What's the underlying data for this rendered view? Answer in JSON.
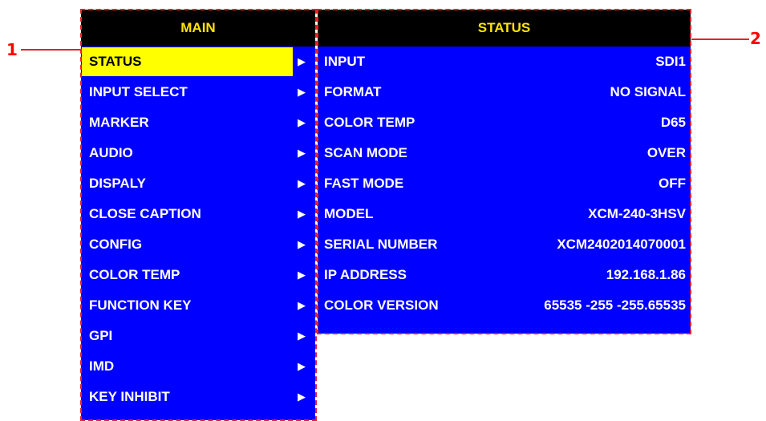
{
  "main": {
    "title": "MAIN",
    "items": [
      {
        "label": "STATUS",
        "arrow": "▶",
        "selected": true
      },
      {
        "label": "INPUT SELECT",
        "arrow": "▶"
      },
      {
        "label": "MARKER",
        "arrow": "▶"
      },
      {
        "label": "AUDIO",
        "arrow": "▶"
      },
      {
        "label": "DISPALY",
        "arrow": "▶"
      },
      {
        "label": "CLOSE CAPTION",
        "arrow": "▶"
      },
      {
        "label": "CONFIG",
        "arrow": "▶"
      },
      {
        "label": "COLOR TEMP",
        "arrow": "▶"
      },
      {
        "label": "FUNCTION KEY",
        "arrow": "▶"
      },
      {
        "label": "GPI",
        "arrow": "▶"
      },
      {
        "label": "IMD",
        "arrow": "▶"
      },
      {
        "label": "KEY INHIBIT",
        "arrow": "▶"
      }
    ]
  },
  "status": {
    "title": "STATUS",
    "rows": [
      {
        "label": "INPUT",
        "value": "SDI1"
      },
      {
        "label": "FORMAT",
        "value": "NO SIGNAL"
      },
      {
        "label": "COLOR TEMP",
        "value": "D65"
      },
      {
        "label": "SCAN MODE",
        "value": "OVER"
      },
      {
        "label": "FAST MODE",
        "value": "OFF"
      },
      {
        "label": "MODEL",
        "value": "XCM-240-3HSV"
      },
      {
        "label": "SERIAL NUMBER",
        "value": "XCM2402014070001"
      },
      {
        "label": "IP ADDRESS",
        "value": "192.168.1.86"
      },
      {
        "label": "COLOR VERSION",
        "value": "65535 -255 -255.65535"
      }
    ]
  },
  "callouts": {
    "one": "1",
    "two": "2"
  },
  "colors": {
    "panel_bg": "#0000ff",
    "header_bg": "#000000",
    "header_text": "#ffe500",
    "highlight": "#ffff00",
    "callout": "#e8202a"
  }
}
